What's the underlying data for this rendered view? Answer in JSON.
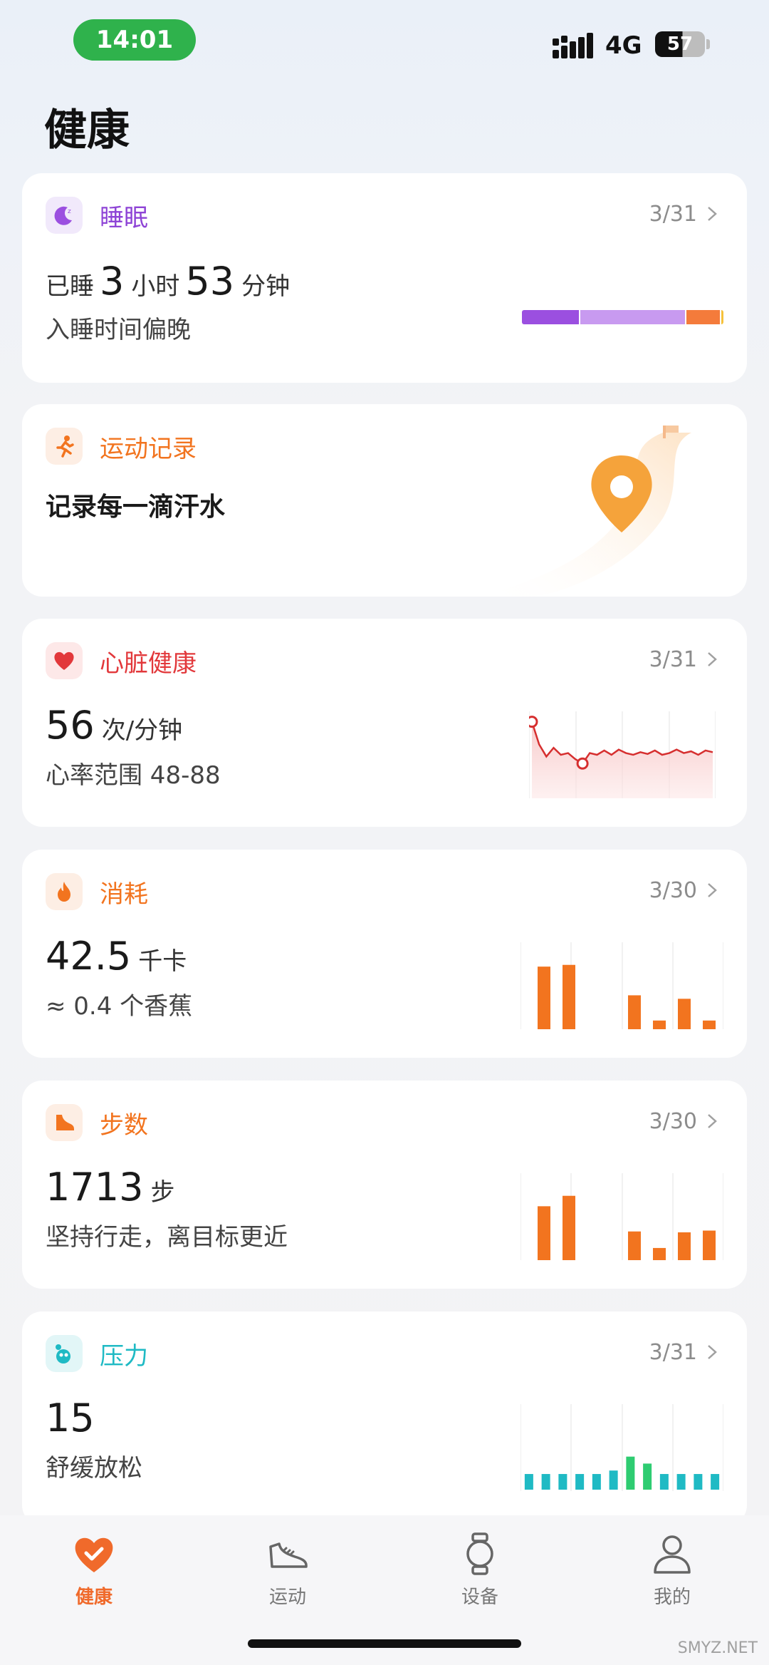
{
  "status_bar": {
    "time": "14:01",
    "network": "4G",
    "battery": "57"
  },
  "page_title": "健康",
  "cards": {
    "sleep": {
      "title": "睡眠",
      "date": "3/31",
      "prefix": "已睡",
      "hours": "3",
      "hours_unit": "小时",
      "minutes": "53",
      "minutes_unit": "分钟",
      "note": "入睡时间偏晚",
      "stages": [
        {
          "name": "deep",
          "fraction": 0.29,
          "color": "#9b4fe0"
        },
        {
          "name": "light",
          "fraction": 0.53,
          "color": "#c89af0"
        },
        {
          "name": "rem",
          "fraction": 0.17,
          "color": "#f47b3b"
        },
        {
          "name": "awake",
          "fraction": 0.01,
          "color": "#f6c23b"
        }
      ],
      "accent": "#8e44d6"
    },
    "exercise": {
      "title": "运动记录",
      "subtitle": "记录每一滴汗水",
      "accent": "#f2741f"
    },
    "heart": {
      "title": "心脏健康",
      "date": "3/31",
      "value": "56",
      "unit": "次/分钟",
      "range_label": "心率范围 48-88",
      "accent": "#e2383b"
    },
    "calories": {
      "title": "消耗",
      "date": "3/30",
      "value": "42.5",
      "unit": "千卡",
      "note": "≈ 0.4 个香蕉",
      "accent": "#f2741f"
    },
    "steps": {
      "title": "步数",
      "date": "3/30",
      "value": "1713",
      "unit": "步",
      "note": "坚持行走，离目标更近",
      "accent": "#f2741f"
    },
    "stress": {
      "title": "压力",
      "date": "3/31",
      "value": "15",
      "note": "舒缓放松",
      "accent": "#1fbac4"
    }
  },
  "chart_data": [
    {
      "id": "calories-mini",
      "type": "bar",
      "values": [
        0.72,
        0.74,
        0.39,
        0.1,
        0.35,
        0.1
      ],
      "ylim": [
        0,
        1
      ]
    },
    {
      "id": "steps-mini",
      "type": "bar",
      "values": [
        0.62,
        0.74,
        0.33,
        0.14,
        0.32,
        0.34
      ],
      "ylim": [
        0,
        1
      ]
    },
    {
      "id": "stress-mini",
      "type": "bar",
      "values": [
        0.18,
        0.18,
        0.18,
        0.18,
        0.18,
        0.22,
        0.38,
        0.3,
        0.18,
        0.18,
        0.18,
        0.18
      ],
      "ylim": [
        0,
        1
      ]
    },
    {
      "id": "heart-mini",
      "type": "line",
      "values": [
        0.88,
        0.62,
        0.48,
        0.58,
        0.5,
        0.52,
        0.45,
        0.4,
        0.52,
        0.5,
        0.55,
        0.5,
        0.56,
        0.52,
        0.5,
        0.53,
        0.51,
        0.55,
        0.5,
        0.52,
        0.56,
        0.52,
        0.54,
        0.5,
        0.55,
        0.53
      ],
      "ylim": [
        0,
        1
      ]
    }
  ],
  "nav": {
    "items": [
      {
        "label": "健康",
        "icon": "heart-check-icon",
        "active": true
      },
      {
        "label": "运动",
        "icon": "shoe-icon",
        "active": false
      },
      {
        "label": "设备",
        "icon": "watch-icon",
        "active": false
      },
      {
        "label": "我的",
        "icon": "person-icon",
        "active": false
      }
    ]
  },
  "watermark": "SMYZ.NET"
}
